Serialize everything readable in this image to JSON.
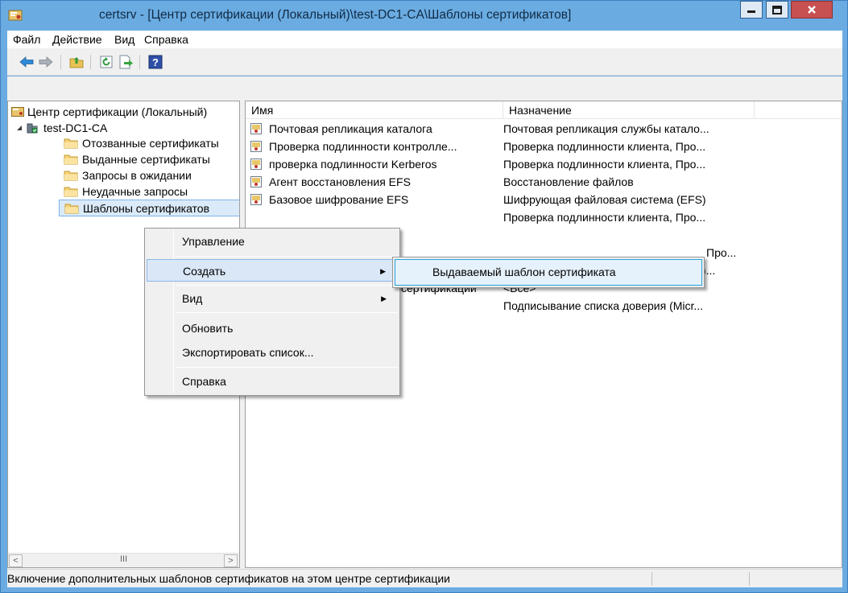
{
  "window": {
    "title": "certsrv - [Центр сертификации (Локальный)\\test-DC1-CA\\Шаблоны сертификатов]",
    "minimize_icon": "minimize-icon",
    "maximize_icon": "maximize-icon",
    "close_icon": "close-icon",
    "close_color": "#c75050",
    "frame_color": "#6aace2"
  },
  "menu": [
    "Файл",
    "Действие",
    "Вид",
    "Справка"
  ],
  "toolbar": {
    "icons": [
      "back-arrow-icon",
      "forward-arrow-icon",
      "up-folder-icon",
      "refresh-icon",
      "export-list-icon",
      "help-icon"
    ]
  },
  "tree": {
    "root": "Центр сертификации (Локальный)",
    "ca": "test-DC1-CA",
    "folders": [
      "Отозванные сертификаты",
      "Выданные сертификаты",
      "Запросы в ожидании",
      "Неудачные запросы",
      "Шаблоны сертификатов"
    ],
    "scroll_thumb": "III"
  },
  "list": {
    "columns": [
      "Имя",
      "Назначение"
    ],
    "rows": [
      {
        "name": "Почтовая репликация каталога",
        "purpose": "Почтовая репликация службы катало..."
      },
      {
        "name": "Проверка подлинности контролле...",
        "purpose": "Проверка подлинности клиента, Про..."
      },
      {
        "name": "проверка подлинности Kerberos",
        "purpose": "Проверка подлинности клиента, Про..."
      },
      {
        "name": "Агент восстановления EFS",
        "purpose": "Восстановление файлов"
      },
      {
        "name": "Базовое шифрование EFS",
        "purpose": "Шифрующая файловая система (EFS)"
      },
      {
        "name": "",
        "purpose": "Проверка подлинности клиента, Про..."
      },
      {
        "name": "",
        "purpose": ""
      },
      {
        "name": "",
        "purpose": "Про..."
      },
      {
        "name": "",
        "purpose": "Шифрующая файловая система (EFS)..."
      },
      {
        "name": "сертификации",
        "purpose": "<Все>"
      },
      {
        "name": "",
        "purpose": "Подписывание списка доверия (Micr..."
      }
    ]
  },
  "context_menu": {
    "items": [
      "Управление",
      "Создать",
      "Вид",
      "Обновить",
      "Экспортировать список...",
      "Справка"
    ],
    "submenu_item": "Выдаваемый шаблон сертификата"
  },
  "status": {
    "text": "Включение дополнительных шаблонов сертификатов на этом центре сертификации"
  }
}
